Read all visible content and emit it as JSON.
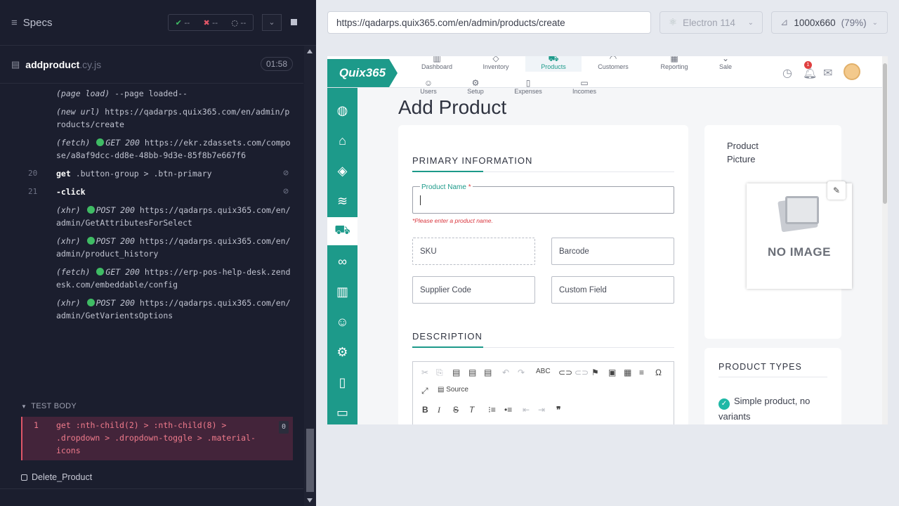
{
  "runner": {
    "specs_label": "Specs",
    "stats": {
      "passed": "--",
      "failed": "--",
      "pending": "--"
    },
    "file": {
      "name": "addproduct",
      "ext": ".cy.js",
      "duration": "01:58"
    },
    "commands": [
      {
        "num": "",
        "type": "(page load)",
        "text": "--page loaded--"
      },
      {
        "num": "",
        "type": "(new url)",
        "text": "https://qadarps.quix365.com/en/admin/products/create"
      },
      {
        "num": "",
        "type": "(fetch)",
        "status": "GET 200",
        "text": "https://ekr.zdassets.com/compose/a8af9dcc-dd8e-48bb-9d3e-85f8b7e667f6"
      },
      {
        "num": "20",
        "type": "get",
        "text": ".button-group > .btn-primary"
      },
      {
        "num": "21",
        "type": "-click",
        "text": ""
      },
      {
        "num": "",
        "type": "(xhr)",
        "status": "POST 200",
        "text": "https://qadarps.quix365.com/en/admin/GetAttributesForSelect"
      },
      {
        "num": "",
        "type": "(xhr)",
        "status": "POST 200",
        "text": "https://qadarps.quix365.com/en/admin/product_history"
      },
      {
        "num": "",
        "type": "(fetch)",
        "status": "GET 200",
        "text": "https://erp-pos-help-desk.zendesk.com/embeddable/config"
      },
      {
        "num": "",
        "type": "(xhr)",
        "status": "POST 200",
        "text": "https://qadarps.quix365.com/en/admin/GetVarientsOptions"
      }
    ],
    "test_body_label": "TEST BODY",
    "failed_command": {
      "num": "1",
      "type": "get",
      "text": ":nth-child(2) > :nth-child(8) > .dropdown > .dropdown-toggle > .material-icons",
      "count": "0"
    },
    "next_test": "Delete_Product"
  },
  "browser_bar": {
    "url": "https://qadarps.quix365.com/en/admin/products/create",
    "browser": "Electron 114",
    "viewport": "1000x660",
    "zoom": "(79%)"
  },
  "app": {
    "logo": "Quix365",
    "nav": [
      {
        "label": "Dashboard"
      },
      {
        "label": "Inventory"
      },
      {
        "label": "Products"
      },
      {
        "label": "Customers"
      },
      {
        "label": "Reporting"
      },
      {
        "label": "Sale"
      },
      {
        "label": "Users"
      },
      {
        "label": "Setup"
      },
      {
        "label": "Expenses"
      },
      {
        "label": "Incomes"
      }
    ],
    "notification_count": "1",
    "page_title": "Add Product",
    "primary_header": "PRIMARY INFORMATION",
    "product_name_label": "Product Name",
    "required_mark": "*",
    "product_name_error": "*Please enter a product name.",
    "sku": "SKU",
    "barcode": "Barcode",
    "supplier_code": "Supplier Code",
    "custom_field": "Custom Field",
    "description_header": "DESCRIPTION",
    "editor_source": "Source",
    "picture_title": "Product Picture",
    "no_image": "NO IMAGE",
    "product_types_header": "PRODUCT TYPES",
    "product_type_option": "Simple product, no variants"
  },
  "colors": {
    "accent": "#1d9a8a",
    "runner_bg": "#1b1e2e",
    "error": "#e05668"
  }
}
